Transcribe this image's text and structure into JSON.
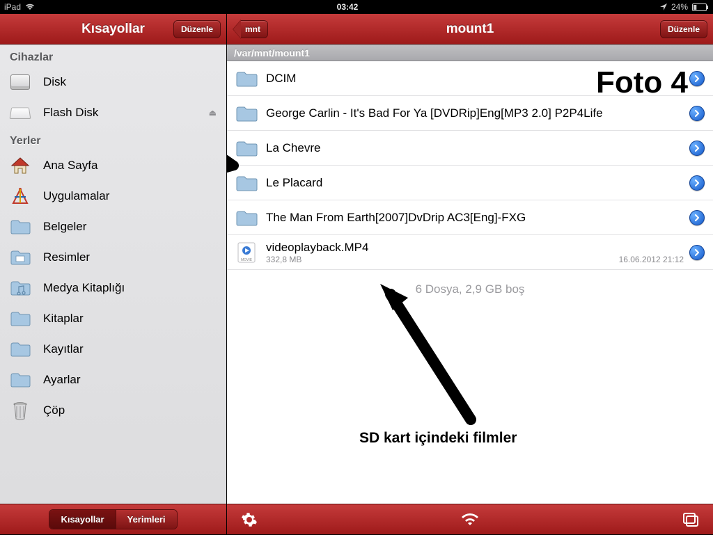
{
  "statusbar": {
    "device": "iPad",
    "time": "03:42",
    "battery": "24%"
  },
  "sidebar": {
    "title": "Kısayollar",
    "edit_label": "Düzenle",
    "sections": {
      "devices_header": "Cihazlar",
      "places_header": "Yerler"
    },
    "devices": [
      {
        "label": "Disk",
        "icon": "harddisk-icon"
      },
      {
        "label": "Flash Disk",
        "icon": "flashdisk-icon",
        "ejectable": true
      }
    ],
    "places": [
      {
        "label": "Ana Sayfa",
        "icon": "home-icon"
      },
      {
        "label": "Uygulamalar",
        "icon": "apps-icon"
      },
      {
        "label": "Belgeler",
        "icon": "folder-icon"
      },
      {
        "label": "Resimler",
        "icon": "pictures-folder-icon"
      },
      {
        "label": "Medya Kitaplığı",
        "icon": "music-folder-icon"
      },
      {
        "label": "Kitaplar",
        "icon": "folder-icon"
      },
      {
        "label": "Kayıtlar",
        "icon": "folder-icon"
      },
      {
        "label": "Ayarlar",
        "icon": "folder-icon"
      },
      {
        "label": "Çöp",
        "icon": "trash-icon"
      }
    ],
    "toolbar_segments": {
      "shortcuts": "Kısayollar",
      "bookmarks": "Yerimleri"
    }
  },
  "main": {
    "back_label": "mnt",
    "title": "mount1",
    "edit_label": "Düzenle",
    "path": "/var/mnt/mount1",
    "files": [
      {
        "name": "DCIM",
        "type": "folder"
      },
      {
        "name": "George Carlin - It's Bad For Ya [DVDRip]Eng[MP3 2.0] P2P4Life",
        "type": "folder"
      },
      {
        "name": "La Chevre",
        "type": "folder"
      },
      {
        "name": "Le Placard",
        "type": "folder"
      },
      {
        "name": "The Man From Earth[2007]DvDrip AC3[Eng]-FXG",
        "type": "folder"
      },
      {
        "name": "videoplayback.MP4",
        "type": "movie",
        "size": "332,8 MB",
        "date": "16.06.2012 21:12"
      }
    ],
    "summary": "6 Dosya, 2,9 GB boş"
  },
  "annotations": {
    "title": "Foto 4",
    "caption": "SD kart içindeki filmler"
  }
}
